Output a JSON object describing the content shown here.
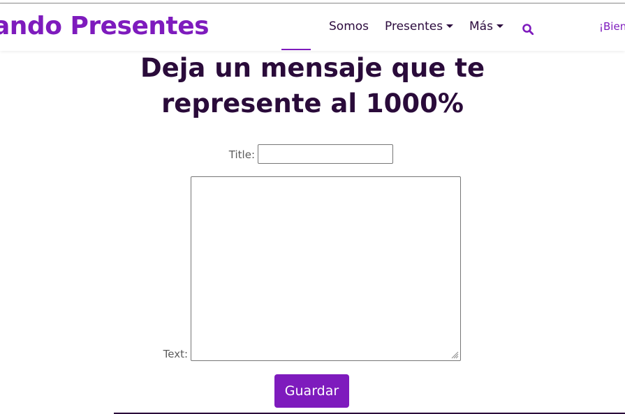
{
  "header": {
    "brand": "ando Presentes",
    "nav": {
      "somos": "Somos",
      "presentes": "Presentes",
      "mas": "Más"
    },
    "search_icon": "search-icon",
    "welcome": "¡Bien"
  },
  "main": {
    "heading_line1": "Deja un mensaje que te",
    "heading_line2": "represente al 1000%",
    "form": {
      "title_label": "Title:",
      "title_value": "",
      "text_label": "Text:",
      "text_value": "",
      "save_label": "Guardar"
    }
  },
  "colors": {
    "brand": "#7e1bbd",
    "heading": "#2a0b3a"
  }
}
